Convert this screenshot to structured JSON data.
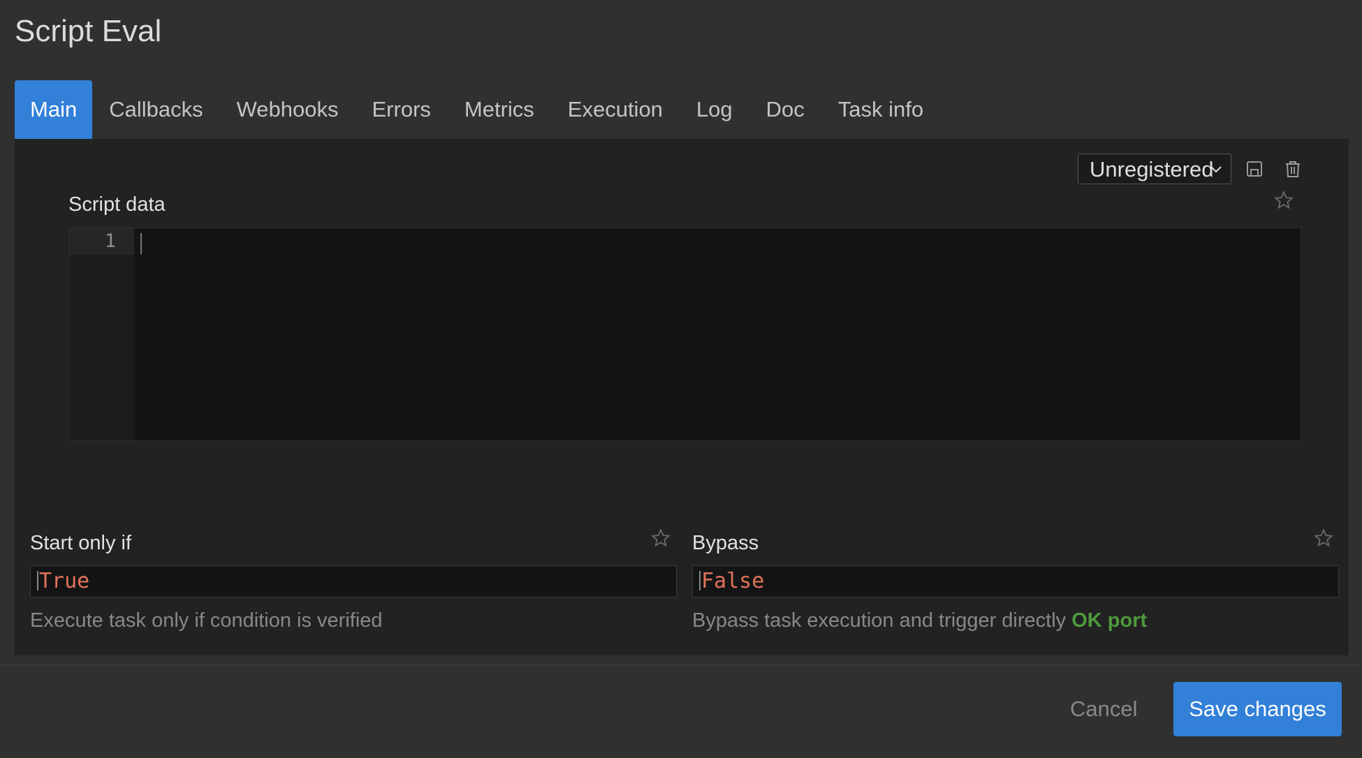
{
  "window": {
    "title": "Script Eval"
  },
  "tabs": [
    {
      "label": "Main",
      "active": true
    },
    {
      "label": "Callbacks"
    },
    {
      "label": "Webhooks"
    },
    {
      "label": "Errors"
    },
    {
      "label": "Metrics"
    },
    {
      "label": "Execution"
    },
    {
      "label": "Log"
    },
    {
      "label": "Doc"
    },
    {
      "label": "Task info"
    }
  ],
  "toolbar": {
    "status_value": "Unregistered",
    "icons": [
      "chevron-down-icon",
      "save-icon",
      "trash-icon",
      "star-icon"
    ]
  },
  "script": {
    "label": "Script data",
    "line_numbers": [
      "1"
    ],
    "content": ""
  },
  "start_only_if": {
    "label": "Start only if",
    "value": "True",
    "help": "Execute task only if condition is verified"
  },
  "bypass": {
    "label": "Bypass",
    "value": "False",
    "help": "Bypass task execution and trigger directly",
    "help_highlight": "OK port"
  },
  "footer": {
    "cancel_label": "Cancel",
    "save_label": "Save changes"
  },
  "colors": {
    "accent": "#3280d8",
    "value_text": "#e0735a",
    "ok_port": "#4d9a3a",
    "background": "#303030",
    "panel": "#222222"
  }
}
